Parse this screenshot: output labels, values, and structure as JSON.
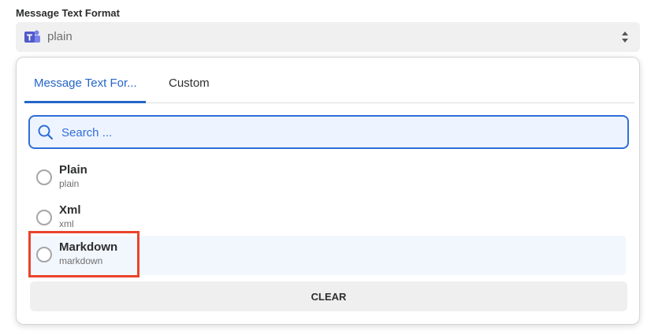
{
  "field": {
    "label": "Message Text Format",
    "selected_value": "plain"
  },
  "icons": {
    "app_logo": "microsoft-teams-logo-icon",
    "select_arrows": "up-down-arrows-icon",
    "search": "search-icon"
  },
  "tabs": [
    {
      "label": "Message Text For...",
      "active": true
    },
    {
      "label": "Custom",
      "active": false
    }
  ],
  "search": {
    "placeholder": "Search ..."
  },
  "options": [
    {
      "title": "Plain",
      "value": "plain"
    },
    {
      "title": "Xml",
      "value": "xml"
    },
    {
      "title": "Markdown",
      "value": "markdown"
    }
  ],
  "clear_label": "CLEAR",
  "colors": {
    "accent": "#2565c8",
    "highlight_box": "#e9442b",
    "teams_purple": "#5059c9"
  }
}
